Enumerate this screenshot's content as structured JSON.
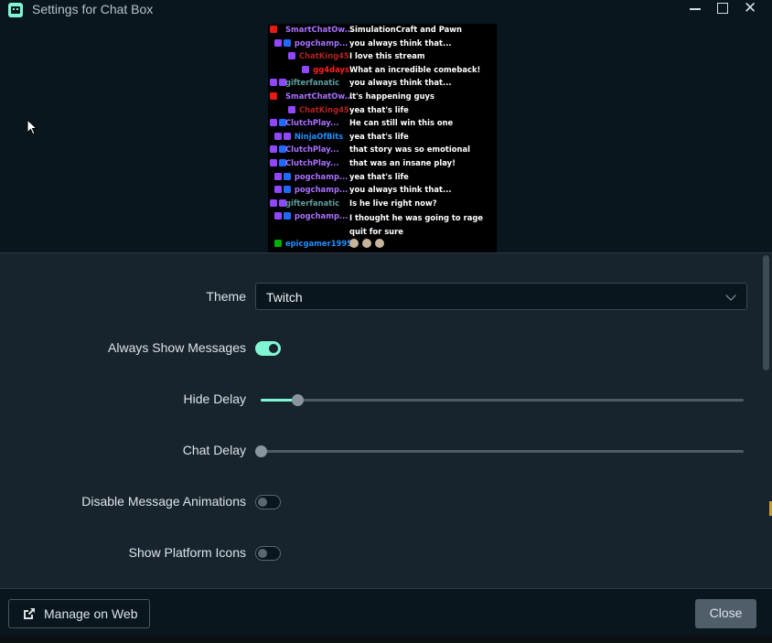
{
  "window": {
    "title": "Settings for Chat Box",
    "minimize_label": "Minimize",
    "maximize_label": "Maximize",
    "close_label": "Close window"
  },
  "preview": {
    "messages": [
      {
        "badges": [
          "red"
        ],
        "name": "SmartChatOw...",
        "name_color": "#a970ff",
        "text": "SimulationCraft and Pawn"
      },
      {
        "badges": [
          "purple",
          "blue"
        ],
        "name": "pogchamp...",
        "name_color": "#a970ff",
        "text": "you always think that..."
      },
      {
        "badges": [
          "purple"
        ],
        "name": "ChatKing45",
        "name_color": "#b22222",
        "text": "I love this stream"
      },
      {
        "badges": [
          "purple"
        ],
        "name": "gg4days",
        "name_color": "#ff2020",
        "text": "What an incredible comeback!"
      },
      {
        "badges": [
          "purple",
          "purple"
        ],
        "name": "gifterfanatic",
        "name_color": "#5f9ea0",
        "text": "you always think that..."
      },
      {
        "badges": [
          "red"
        ],
        "name": "SmartChatOw...",
        "name_color": "#a970ff",
        "text": "It's happening guys"
      },
      {
        "badges": [
          "purple"
        ],
        "name": "ChatKing45",
        "name_color": "#b22222",
        "text": "yea that's life"
      },
      {
        "badges": [
          "purple",
          "blue"
        ],
        "name": "ClutchPlay...",
        "name_color": "#a970ff",
        "text": "He can still win this one"
      },
      {
        "badges": [
          "purple",
          "purple"
        ],
        "name": "NinjaOfBits",
        "name_color": "#1e90ff",
        "text": "yea that's life"
      },
      {
        "badges": [
          "purple",
          "blue"
        ],
        "name": "ClutchPlay...",
        "name_color": "#a970ff",
        "text": "that story was so emotional"
      },
      {
        "badges": [
          "purple",
          "blue"
        ],
        "name": "ClutchPlay...",
        "name_color": "#a970ff",
        "text": "that was an insane play!"
      },
      {
        "badges": [
          "purple",
          "blue"
        ],
        "name": "pogchamp...",
        "name_color": "#a970ff",
        "text": "yea that's life"
      },
      {
        "badges": [
          "purple",
          "blue"
        ],
        "name": "pogchamp...",
        "name_color": "#a970ff",
        "text": "you always think that..."
      },
      {
        "badges": [
          "purple",
          "purple"
        ],
        "name": "gifterfanatic",
        "name_color": "#5f9ea0",
        "text": "Is he live right now?"
      },
      {
        "badges": [
          "purple",
          "blue"
        ],
        "name": "pogchamp...",
        "name_color": "#a970ff",
        "text": "I thought he was going to rage quit for sure"
      },
      {
        "badges": [
          "green"
        ],
        "name": "epicgamer1995",
        "name_color": "#1e90ff",
        "text": ""
      }
    ]
  },
  "settings": {
    "theme": {
      "label": "Theme",
      "value": "Twitch"
    },
    "always_show": {
      "label": "Always Show Messages",
      "on": true
    },
    "hide_delay": {
      "label": "Hide Delay",
      "fraction": 0.076
    },
    "chat_delay": {
      "label": "Chat Delay",
      "fraction": 0.0
    },
    "disable_animations": {
      "label": "Disable Message Animations",
      "on": false
    },
    "platform_icons": {
      "label": "Show Platform Icons",
      "on": false
    }
  },
  "footer": {
    "manage_label": "Manage on Web",
    "close_label": "Close"
  },
  "colors": {
    "accent": "#80f5d2",
    "background": "#17242d",
    "titlebar": "#09161d"
  },
  "icons": {
    "app": "streamlabs-app-icon",
    "external": "external-link-icon",
    "select": "chevron-down-icon"
  }
}
